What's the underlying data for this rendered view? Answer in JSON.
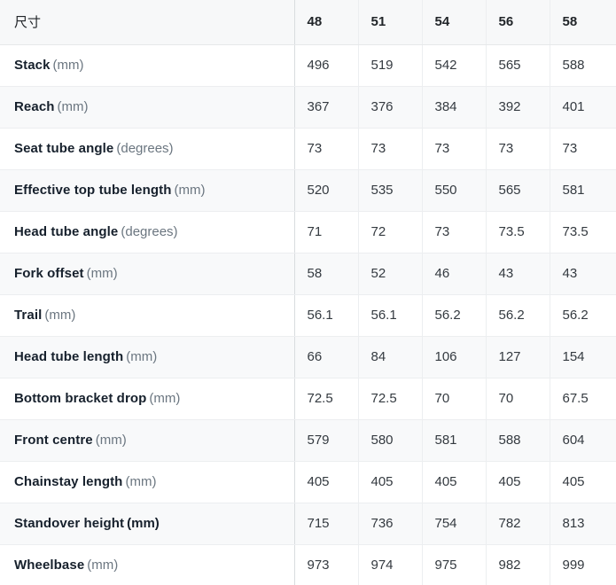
{
  "table": {
    "header": {
      "label_column": "尺寸",
      "sizes": [
        "48",
        "51",
        "54",
        "56",
        "58"
      ]
    },
    "rows": [
      {
        "name": "Stack",
        "unit": "(mm)",
        "unit_bold": false,
        "values": [
          "496",
          "519",
          "542",
          "565",
          "588"
        ]
      },
      {
        "name": "Reach",
        "unit": "(mm)",
        "unit_bold": false,
        "values": [
          "367",
          "376",
          "384",
          "392",
          "401"
        ]
      },
      {
        "name": "Seat tube angle",
        "unit": "(degrees)",
        "unit_bold": false,
        "values": [
          "73",
          "73",
          "73",
          "73",
          "73"
        ]
      },
      {
        "name": "Effective top tube length",
        "unit": "(mm)",
        "unit_bold": false,
        "values": [
          "520",
          "535",
          "550",
          "565",
          "581"
        ]
      },
      {
        "name": "Head tube angle",
        "unit": "(degrees)",
        "unit_bold": false,
        "values": [
          "71",
          "72",
          "73",
          "73.5",
          "73.5"
        ]
      },
      {
        "name": "Fork offset",
        "unit": "(mm)",
        "unit_bold": false,
        "values": [
          "58",
          "52",
          "46",
          "43",
          "43"
        ]
      },
      {
        "name": "Trail",
        "unit": "(mm)",
        "unit_bold": false,
        "values": [
          "56.1",
          "56.1",
          "56.2",
          "56.2",
          "56.2"
        ]
      },
      {
        "name": "Head tube length",
        "unit": "(mm)",
        "unit_bold": false,
        "values": [
          "66",
          "84",
          "106",
          "127",
          "154"
        ]
      },
      {
        "name": "Bottom bracket drop",
        "unit": "(mm)",
        "unit_bold": false,
        "values": [
          "72.5",
          "72.5",
          "70",
          "70",
          "67.5"
        ]
      },
      {
        "name": "Front centre",
        "unit": "(mm)",
        "unit_bold": false,
        "values": [
          "579",
          "580",
          "581",
          "588",
          "604"
        ]
      },
      {
        "name": "Chainstay length",
        "unit": "(mm)",
        "unit_bold": false,
        "values": [
          "405",
          "405",
          "405",
          "405",
          "405"
        ]
      },
      {
        "name": "Standover height",
        "unit": "(mm)",
        "unit_bold": true,
        "values": [
          "715",
          "736",
          "754",
          "782",
          "813"
        ]
      },
      {
        "name": "Wheelbase",
        "unit": "(mm)",
        "unit_bold": false,
        "values": [
          "973",
          "974",
          "975",
          "982",
          "999"
        ]
      }
    ]
  },
  "colors": {
    "header_background": "#f7f8f9",
    "row_background": "#ffffff",
    "row_background_alt": "#f8f9fa",
    "label_text": "#16202c",
    "unit_text": "#6b7680",
    "value_text": "#343a40",
    "border_light": "#eceef0",
    "border_strong": "#d9dcdf"
  }
}
